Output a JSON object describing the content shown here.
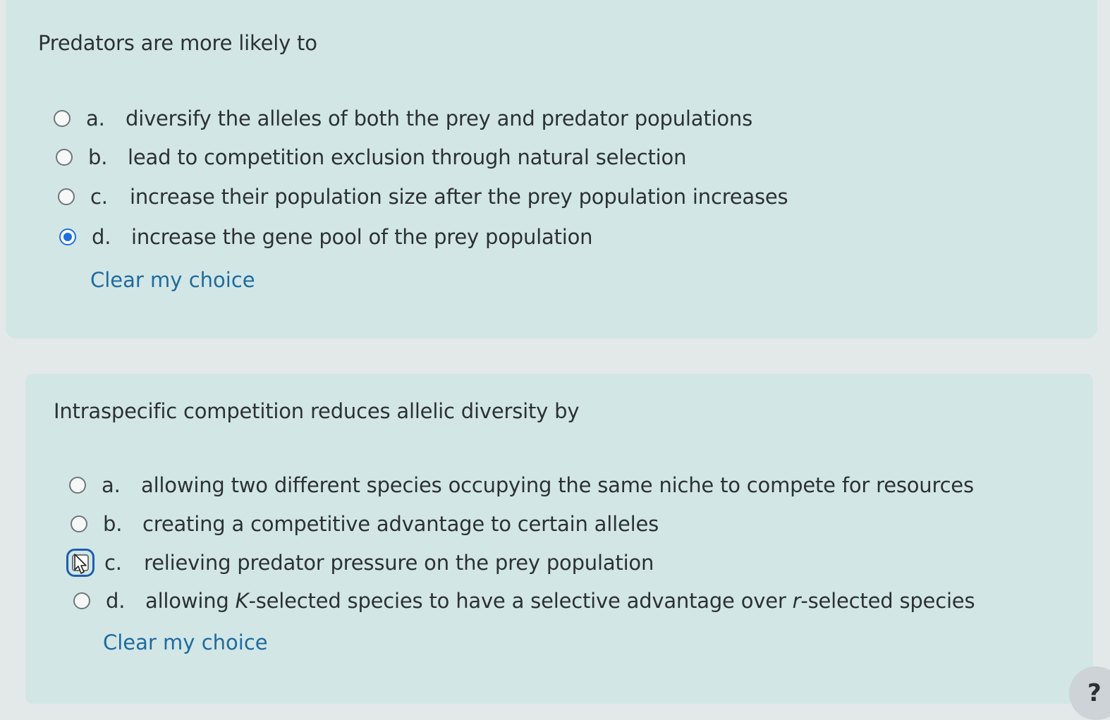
{
  "question1": {
    "text": "Predators are more likely to",
    "options": [
      {
        "letter": "a.",
        "text": "diversify the alleles of both the prey and predator populations",
        "selected": false
      },
      {
        "letter": "b.",
        "text": "lead to competition exclusion through natural selection",
        "selected": false
      },
      {
        "letter": "c.",
        "text": "increase their population size after the prey population increases",
        "selected": false
      },
      {
        "letter": "d.",
        "text": "increase the gene pool of the prey population",
        "selected": true
      }
    ],
    "clear_label": "Clear my choice"
  },
  "question2": {
    "text": "Intraspecific competition reduces allelic diversity by",
    "options": [
      {
        "letter": "a.",
        "text": "allowing two different species occupying the same niche to compete for resources",
        "selected": false
      },
      {
        "letter": "b.",
        "text": "creating a competitive advantage to certain alleles",
        "selected": false
      },
      {
        "letter": "c.",
        "text": "relieving predator pressure on the prey population",
        "selected": false,
        "focused": true
      },
      {
        "letter": "d.",
        "text_prefix": "allowing ",
        "k_italic": "K",
        "text_mid": "-selected species to have a selective advantage over ",
        "r_italic": "r",
        "text_suffix": "-selected species",
        "selected": false
      }
    ],
    "clear_label": "Clear my choice"
  },
  "help": {
    "label": "?"
  },
  "colors": {
    "accent": "#1d6fe0",
    "link": "#1d6b9f",
    "card": "#d3e6e6"
  }
}
